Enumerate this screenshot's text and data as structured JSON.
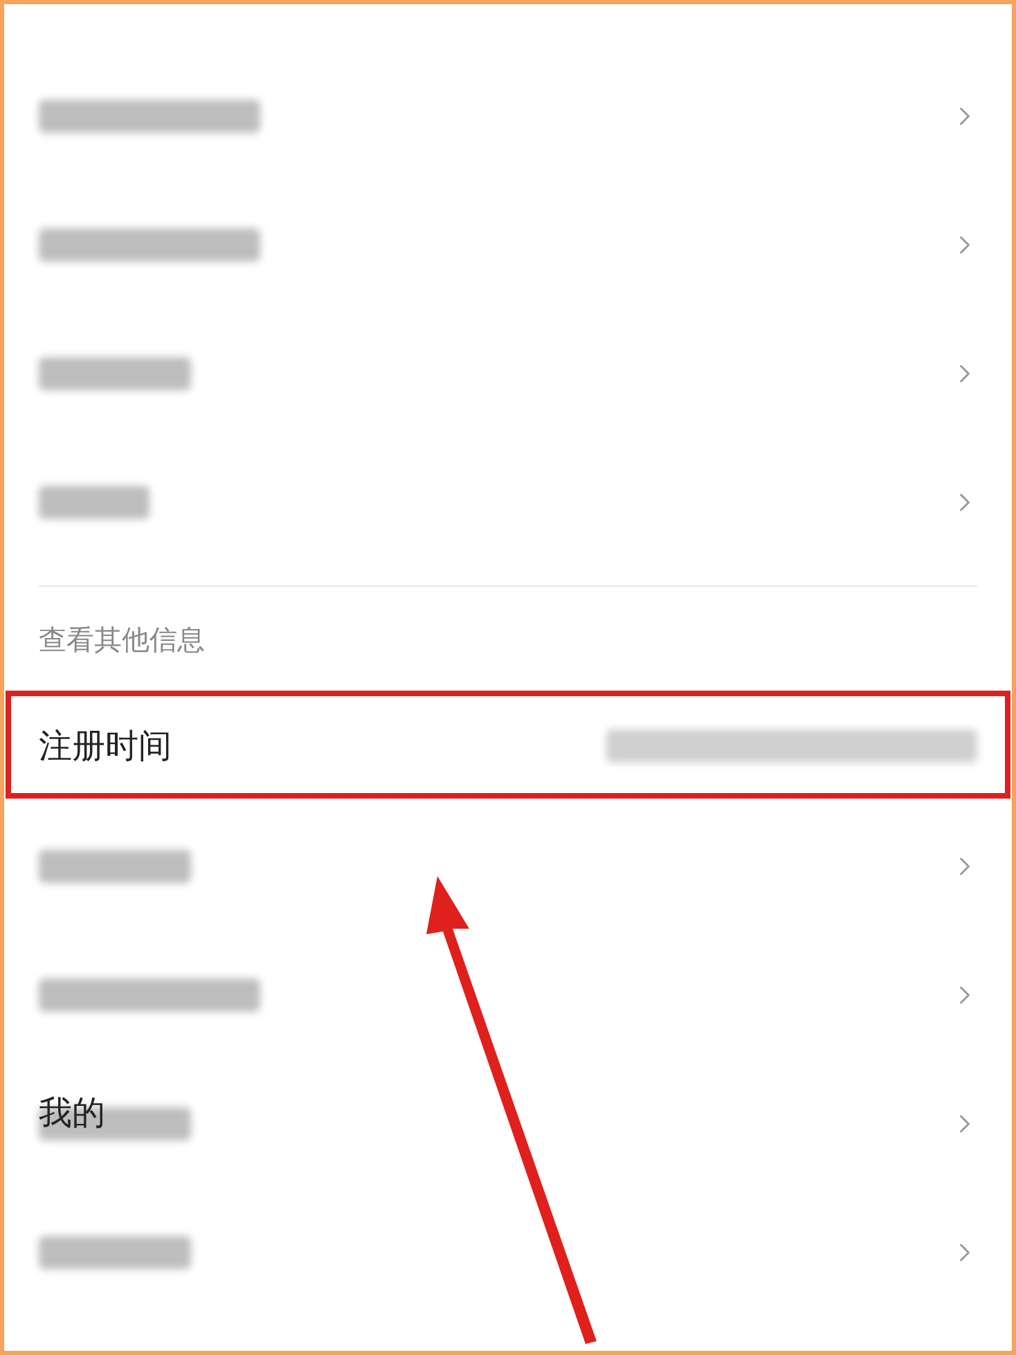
{
  "list_top": [
    {
      "kind": "blurred_long"
    },
    {
      "kind": "blurred_long"
    },
    {
      "kind": "blurred_medium"
    },
    {
      "kind": "blurred_short"
    }
  ],
  "section_title": "查看其他信息",
  "highlighted_row": {
    "label": "注册时间",
    "value_blurred": true,
    "highlighted": true
  },
  "list_bottom": [
    {
      "kind": "blurred_medium"
    },
    {
      "kind": "blurred_long"
    },
    {
      "kind": "partly_blurred",
      "text": "我的"
    },
    {
      "kind": "blurred_medium"
    }
  ],
  "annotation_arrow": true
}
